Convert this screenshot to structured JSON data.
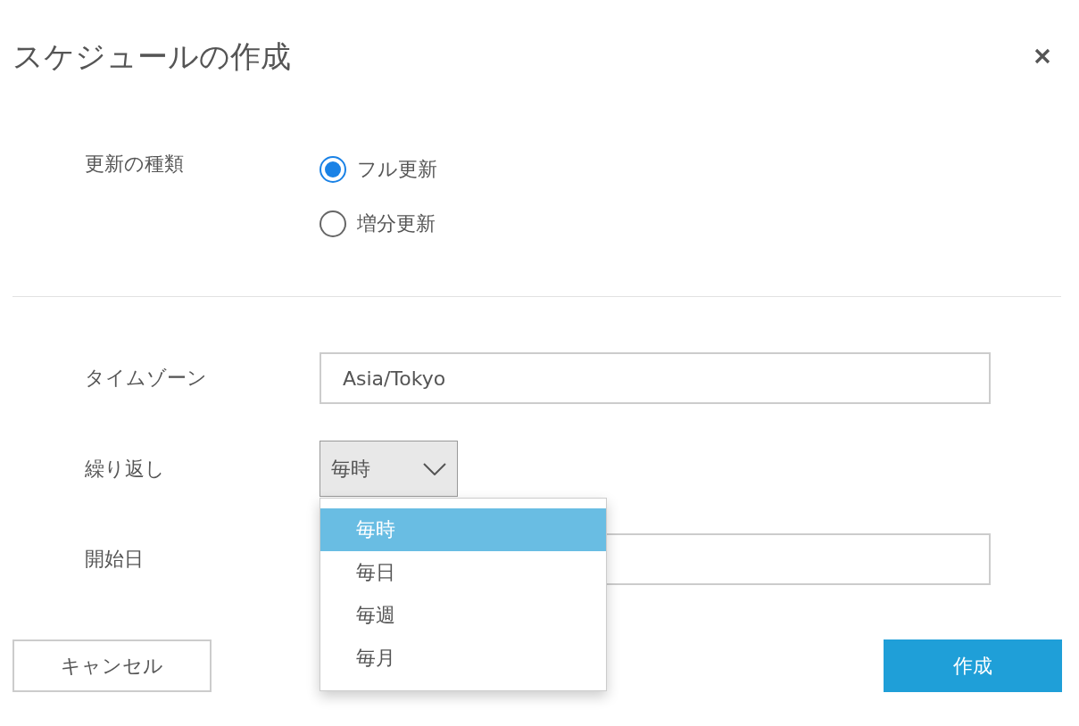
{
  "title": "スケジュールの作成",
  "update_type": {
    "label": "更新の種類",
    "options": [
      {
        "label": "フル更新",
        "selected": true
      },
      {
        "label": "増分更新",
        "selected": false
      }
    ]
  },
  "time_zone": {
    "label": "タイムゾーン",
    "value": "Asia/Tokyo"
  },
  "repeat": {
    "label": "繰り返し",
    "value": "毎時",
    "expanded": true,
    "options": [
      {
        "label": "毎時",
        "selected": true
      },
      {
        "label": "毎日",
        "selected": false
      },
      {
        "label": "毎週",
        "selected": false
      },
      {
        "label": "毎月",
        "selected": false
      }
    ]
  },
  "start_date": {
    "label": "開始日"
  },
  "buttons": [
    {
      "label": "キャンセル",
      "kind": "secondary"
    },
    {
      "label": "作成",
      "kind": "primary"
    }
  ]
}
